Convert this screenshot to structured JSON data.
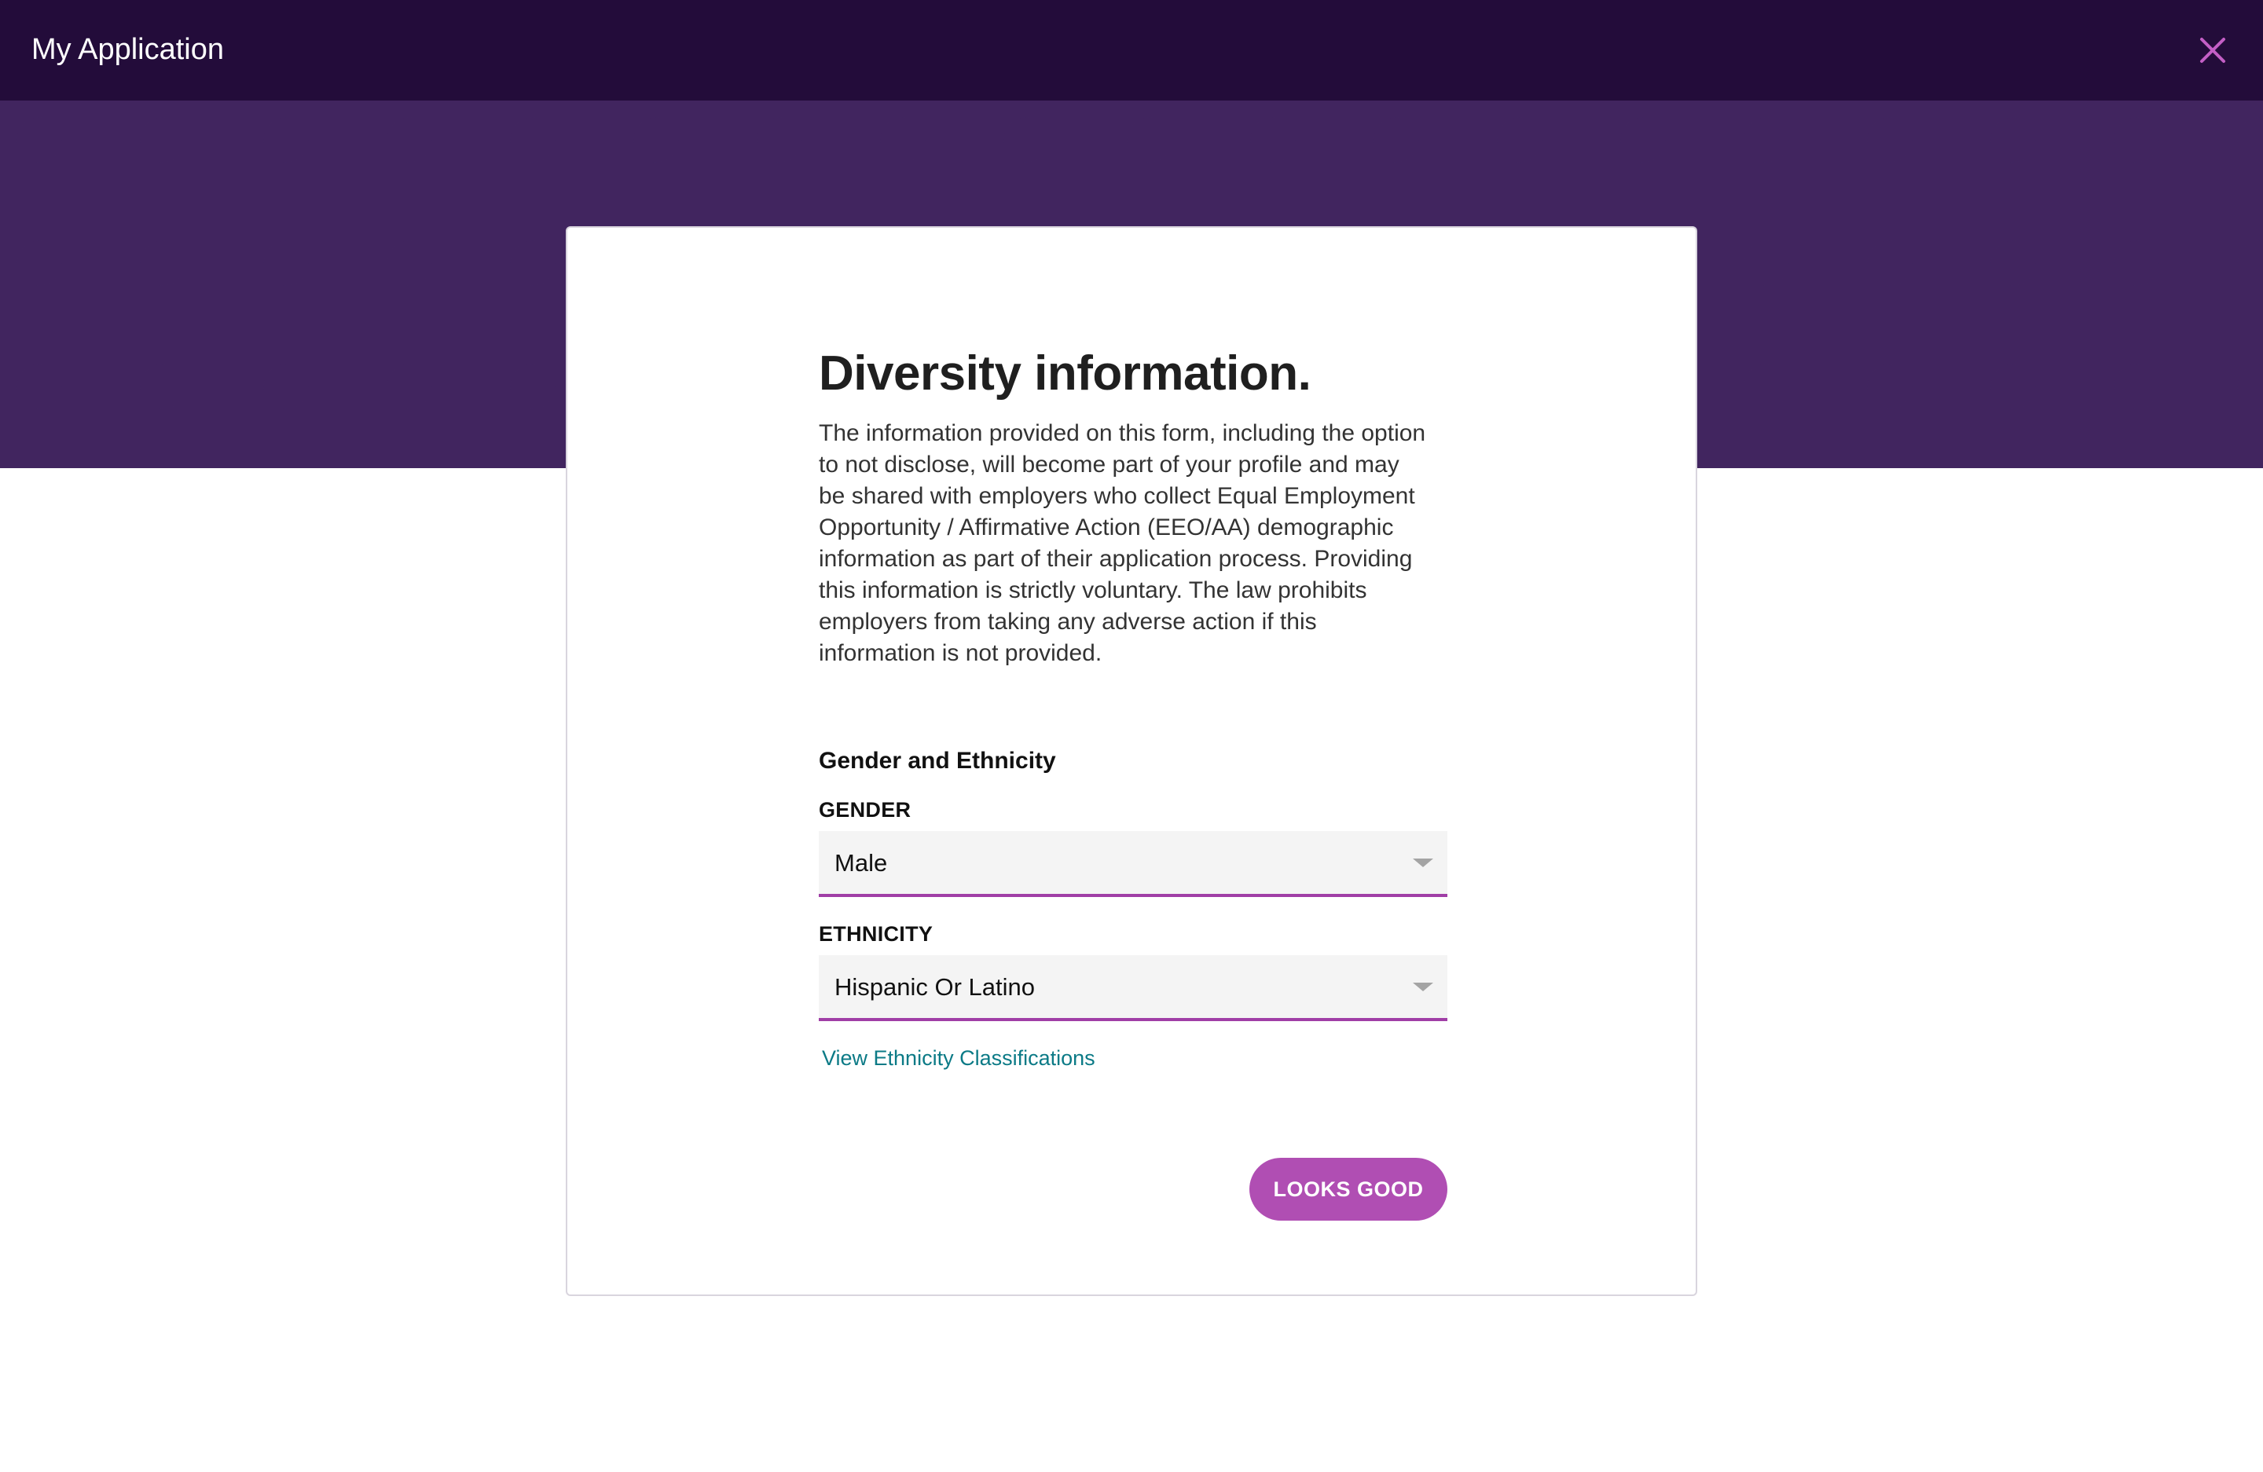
{
  "header": {
    "app_title": "My Application",
    "close_icon": "close-icon",
    "close_color": "#c35fc6",
    "background": "#230c3a"
  },
  "banner": {
    "pattern": "geometric-circles-triangles",
    "colors": [
      "#230c3a",
      "#41255f"
    ]
  },
  "form": {
    "title": "Diversity information.",
    "intro": "The information provided on this form, including the option to not disclose, will become part of your profile and may be shared with employers who collect Equal Employment Opportunity / Affirmative Action (EEO/AA) demographic information as part of their application process. Providing this information is strictly voluntary. The law prohibits employers from taking any adverse action if this information is not provided.",
    "section_title": "Gender and Ethnicity",
    "gender": {
      "label": "GENDER",
      "value": "Male",
      "icon": "chevron-down-icon"
    },
    "ethnicity": {
      "label": "ETHNICITY",
      "value": "Hispanic Or Latino",
      "icon": "chevron-down-icon"
    },
    "classification_link": "View Ethnicity Classifications",
    "submit_label": "LOOKS GOOD"
  },
  "colors": {
    "accent": "#a03ea6",
    "button": "#b04eb3",
    "link": "#0b7a86"
  }
}
